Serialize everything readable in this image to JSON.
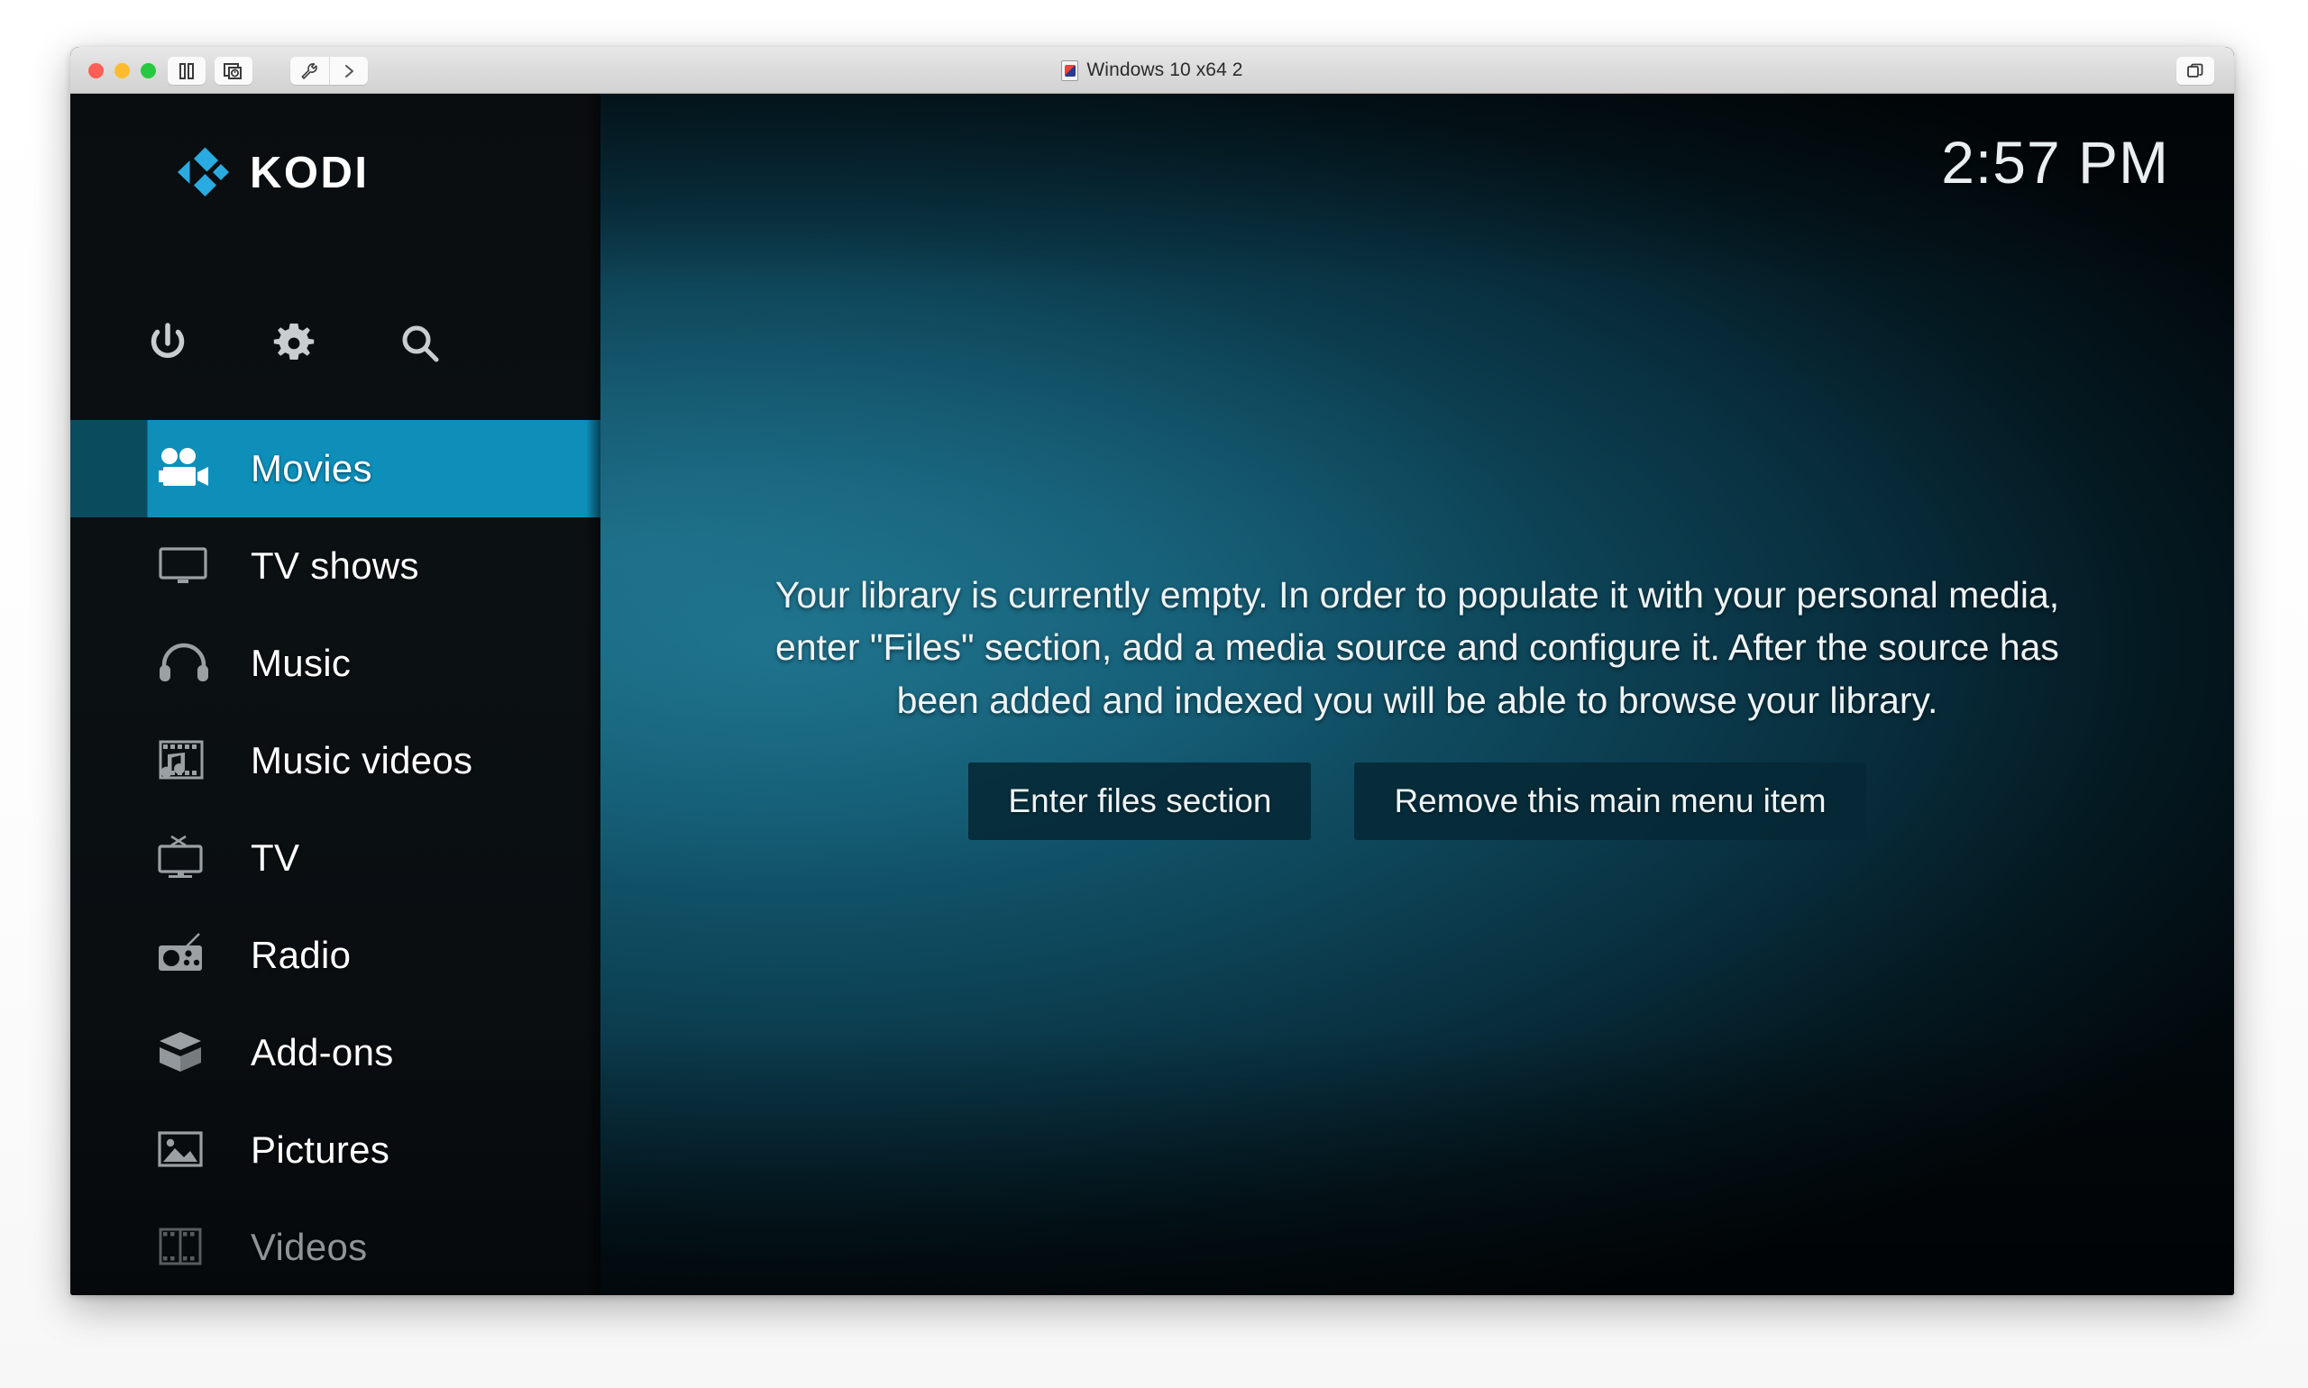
{
  "window": {
    "title": "Windows 10 x64 2",
    "title_icon": "vm-document-icon",
    "controls": {
      "close": "close-button",
      "minimize": "minimize-button",
      "zoom": "zoom-button",
      "pause": "pause-button",
      "snapshot": "snapshot-button",
      "settings": "settings-button",
      "expand": "expand-button",
      "restore": "restore-button"
    }
  },
  "app": {
    "brand": "KODI",
    "clock": "2:57 PM",
    "accent_color": "#0d8fba",
    "accent_icon_color": "#0a4b5e",
    "logo_color": "#29abe2"
  },
  "quickbar": [
    {
      "name": "power-icon",
      "label": "Power"
    },
    {
      "name": "gear-icon",
      "label": "Settings"
    },
    {
      "name": "search-icon",
      "label": "Search"
    }
  ],
  "sidebar": {
    "items": [
      {
        "label": "Movies",
        "icon": "movie-camera-icon",
        "state": "selected"
      },
      {
        "label": "TV shows",
        "icon": "monitor-icon",
        "state": "normal"
      },
      {
        "label": "Music",
        "icon": "headphones-icon",
        "state": "normal"
      },
      {
        "label": "Music videos",
        "icon": "film-music-icon",
        "state": "normal"
      },
      {
        "label": "TV",
        "icon": "retro-tv-icon",
        "state": "normal"
      },
      {
        "label": "Radio",
        "icon": "radio-icon",
        "state": "normal"
      },
      {
        "label": "Add-ons",
        "icon": "open-box-icon",
        "state": "normal"
      },
      {
        "label": "Pictures",
        "icon": "picture-icon",
        "state": "normal"
      },
      {
        "label": "Videos",
        "icon": "film-strip-icon",
        "state": "dim"
      }
    ]
  },
  "main": {
    "empty_message": "Your library is currently empty. In order to populate it with your personal media, enter \"Files\" section, add a media source and configure it. After the source has been added and indexed you will be able to browse your library.",
    "buttons": {
      "enter_files": "Enter files section",
      "remove_item": "Remove this main menu item"
    }
  }
}
